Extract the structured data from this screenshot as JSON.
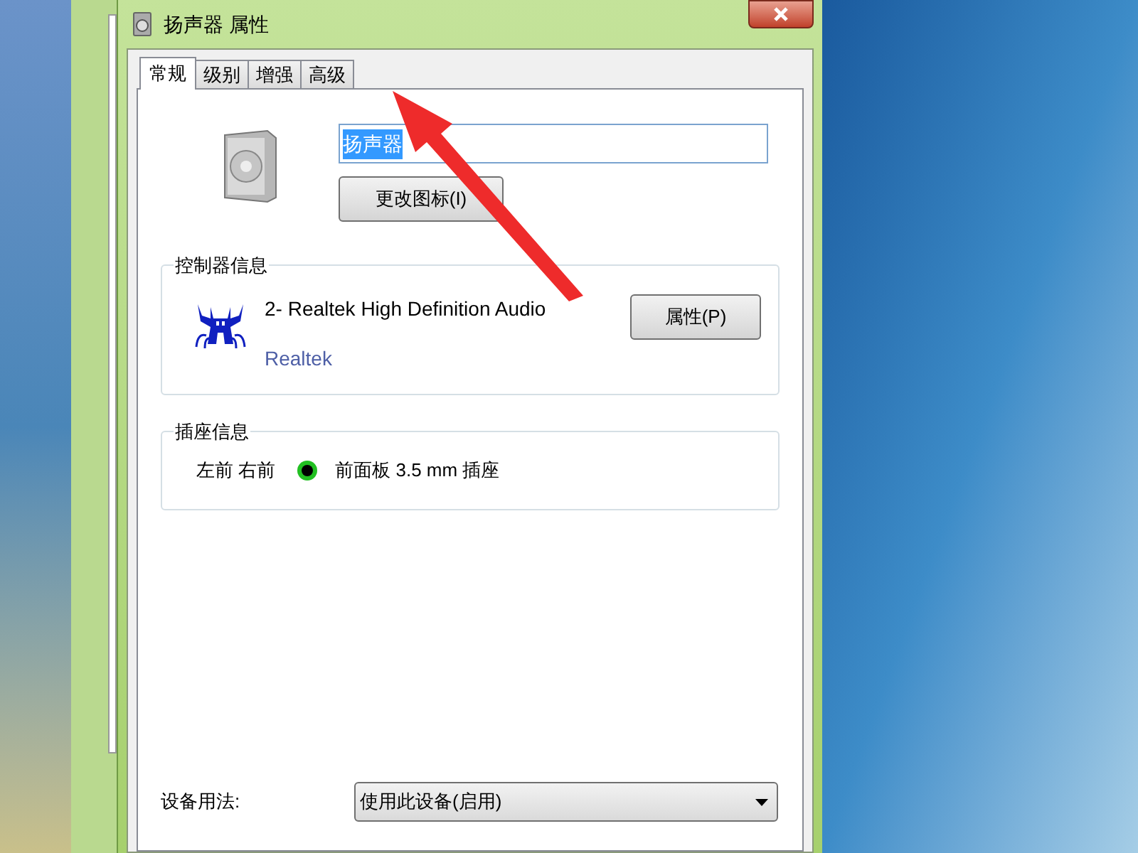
{
  "window": {
    "title": "扬声器 属性"
  },
  "tabs": [
    {
      "label": "常规",
      "selected": true
    },
    {
      "label": "级别",
      "selected": false
    },
    {
      "label": "增强",
      "selected": false
    },
    {
      "label": "高级",
      "selected": false
    }
  ],
  "name_field": {
    "value": "扬声器",
    "highlighted": true
  },
  "change_icon_button": "更改图标(I)",
  "controller": {
    "heading": "控制器信息",
    "device": "2- Realtek High Definition Audio",
    "vendor": "Realtek",
    "button": "属性(P)"
  },
  "jack": {
    "heading": "插座信息",
    "channels": "左前 右前",
    "label": "前面板 3.5 mm 插座"
  },
  "usage": {
    "label": "设备用法:",
    "value": "使用此设备(启用)"
  }
}
